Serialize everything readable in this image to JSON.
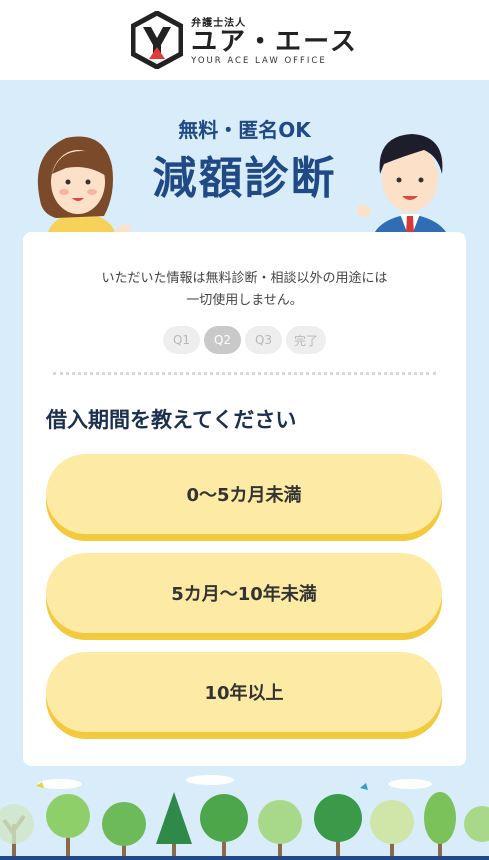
{
  "header": {
    "org_type": "弁護士法人",
    "name": "ユア・エース",
    "english": "YOUR ACE LAW OFFICE"
  },
  "hero": {
    "subtitle": "無料・匿名OK",
    "title": "減額診断"
  },
  "card": {
    "notice_line1": "いただいた情報は無料診断・相談以外の用途には",
    "notice_line2": "一切使用しません。",
    "steps": [
      {
        "label": "Q1",
        "active": false
      },
      {
        "label": "Q2",
        "active": true
      },
      {
        "label": "Q3",
        "active": false
      },
      {
        "label": "完了",
        "active": false
      }
    ],
    "question": "借入期間を教えてください",
    "options": [
      "0〜5カ月未満",
      "5カ月〜10年未満",
      "10年以上"
    ]
  },
  "colors": {
    "brand_navy": "#1f4a86",
    "background": "#d8ecfa",
    "option_fill": "#fdeaa4",
    "option_shadow": "#f3c93e"
  }
}
